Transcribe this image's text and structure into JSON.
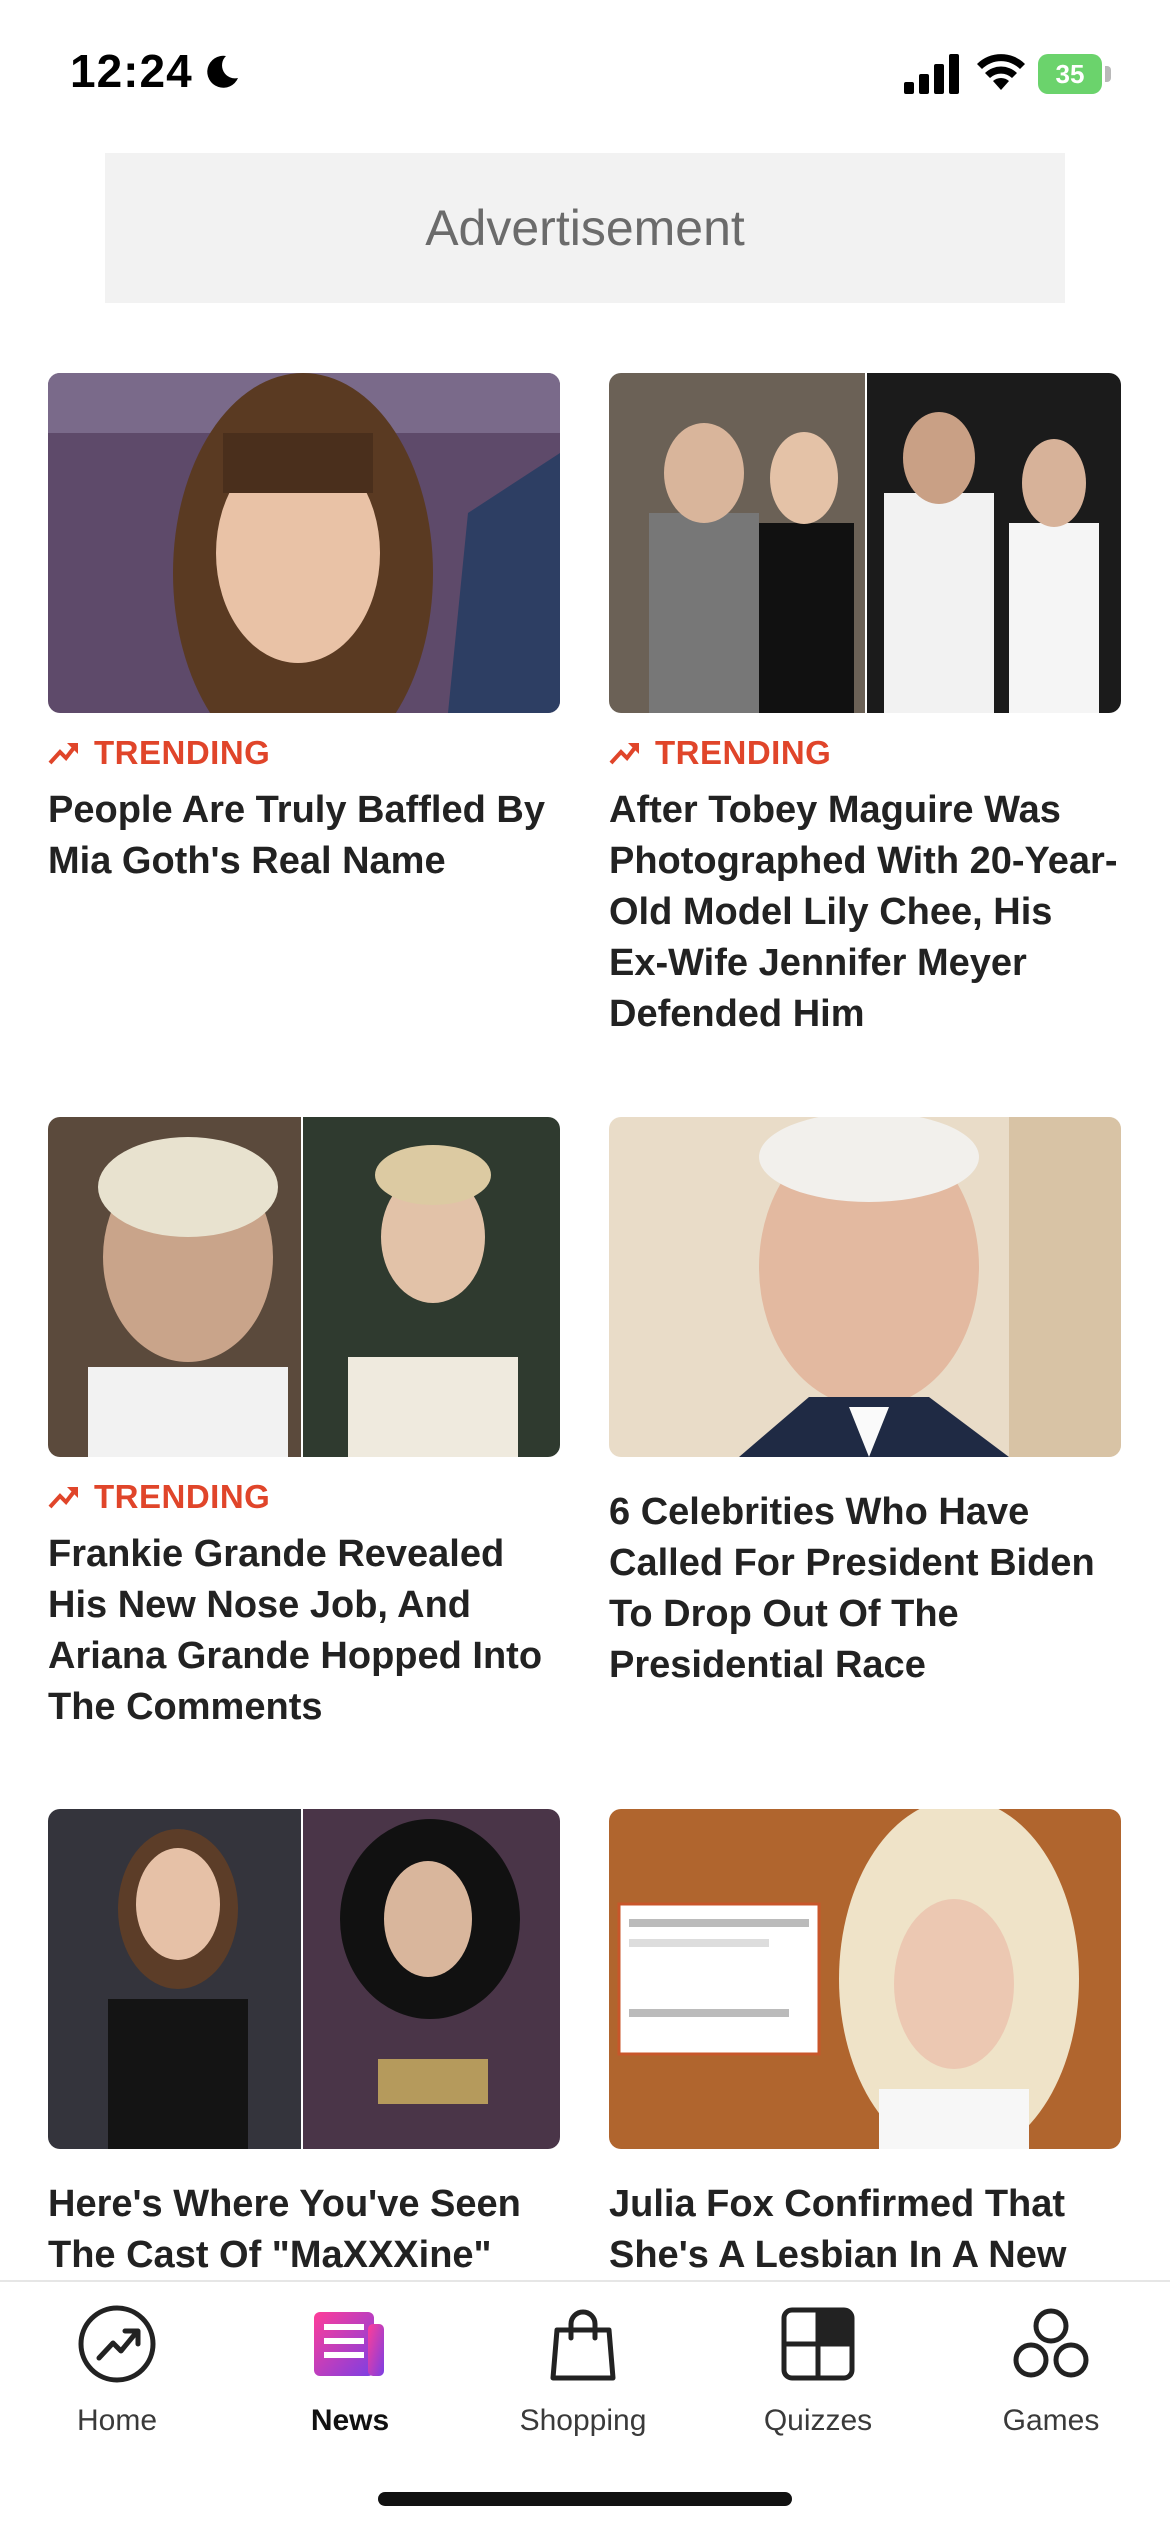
{
  "status_bar": {
    "time": "12:24",
    "battery": "35"
  },
  "ad": {
    "label": "Advertisement"
  },
  "articles": [
    {
      "tag": "TRENDING",
      "title": "People Are Truly Baffled By Mia Goth's Real Name"
    },
    {
      "tag": "TRENDING",
      "title": "After Tobey Maguire Was Photographed With 20-Year-Old Model Lily Chee, His Ex-Wife Jennifer Meyer Defended Him"
    },
    {
      "tag": "TRENDING",
      "title": "Frankie Grande Revealed His New Nose Job, And Ariana Grande Hopped Into The Comments"
    },
    {
      "tag": "",
      "title": "6 Celebrities Who Have Called For President Biden To Drop Out Of The Presidential Race"
    },
    {
      "tag": "",
      "title": "Here's Where You've Seen The Cast Of \"MaXXXine\""
    },
    {
      "tag": "",
      "title": "Julia Fox Confirmed That She's A Lesbian In A New"
    }
  ],
  "nav": {
    "items": [
      {
        "label": "Home",
        "icon": "trending-icon"
      },
      {
        "label": "News",
        "icon": "news-icon"
      },
      {
        "label": "Shopping",
        "icon": "shopping-bag-icon"
      },
      {
        "label": "Quizzes",
        "icon": "quizzes-icon"
      },
      {
        "label": "Games",
        "icon": "games-icon"
      }
    ],
    "active": "News"
  },
  "colors": {
    "accent": "#e0452a",
    "news_gradient": [
      "#ff3d98",
      "#7b3fe4"
    ]
  }
}
